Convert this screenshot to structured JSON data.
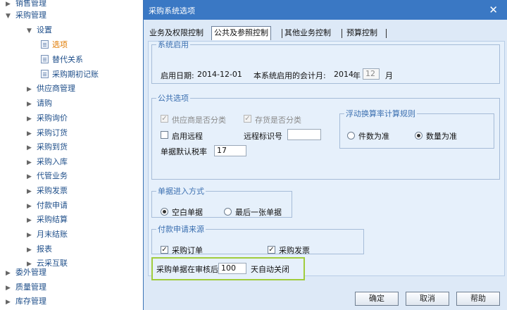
{
  "nav": {
    "items": [
      {
        "label": "销售管理",
        "arrow": "▶",
        "level": 1
      },
      {
        "label": "采购管理",
        "arrow": "▼",
        "level": 1
      },
      {
        "label": "设置",
        "arrow": "▼",
        "level": 2
      },
      {
        "label": "选项",
        "icon": "document-icon",
        "level": 3,
        "selected": true
      },
      {
        "label": "替代关系",
        "icon": "document-icon",
        "level": 3
      },
      {
        "label": "采购期初记账",
        "icon": "document-icon",
        "level": 3
      },
      {
        "label": "供应商管理",
        "arrow": "▶",
        "level": 2
      },
      {
        "label": "请购",
        "arrow": "▶",
        "level": 2
      },
      {
        "label": "采购询价",
        "arrow": "▶",
        "level": 2
      },
      {
        "label": "采购订货",
        "arrow": "▶",
        "level": 2
      },
      {
        "label": "采购到货",
        "arrow": "▶",
        "level": 2
      },
      {
        "label": "采购入库",
        "arrow": "▶",
        "level": 2
      },
      {
        "label": "代管业务",
        "arrow": "▶",
        "level": 2
      },
      {
        "label": "采购发票",
        "arrow": "▶",
        "level": 2
      },
      {
        "label": "付款申请",
        "arrow": "▶",
        "level": 2
      },
      {
        "label": "采购结算",
        "arrow": "▶",
        "level": 2
      },
      {
        "label": "月末结账",
        "arrow": "▶",
        "level": 2
      },
      {
        "label": "报表",
        "arrow": "▶",
        "level": 2
      },
      {
        "label": "云采互联",
        "arrow": "▶",
        "level": 2
      },
      {
        "label": "委外管理",
        "arrow": "▶",
        "level": 1
      },
      {
        "label": "质量管理",
        "arrow": "▶",
        "level": 1
      },
      {
        "label": "库存管理",
        "arrow": "▶",
        "level": 1
      }
    ]
  },
  "dialog": {
    "title": "采购系统选项",
    "close": "✕",
    "tabs": [
      "业务及权限控制",
      "公共及参照控制",
      "其他业务控制",
      "预算控制"
    ],
    "active_tab": 1,
    "system_enable": {
      "legend": "系统启用",
      "start_date_label": "启用日期:",
      "start_date": "2014-12-01",
      "period_label": "本系统启用的会计月:",
      "year": "2014",
      "year_unit": "年",
      "month": "12",
      "month_unit": "月"
    },
    "common": {
      "legend": "公共选项",
      "vendor_classify": "供应商是否分类",
      "inventory_classify": "存货是否分类",
      "enable_remote": "启用远程",
      "remote_id_label": "远程标识号",
      "remote_id_value": "",
      "tax_label": "单据默认税率",
      "tax_value": "17",
      "float_rule": {
        "legend": "浮动换算率计算规则",
        "piece": "件数为准",
        "quantity": "数量为准",
        "selected": "quantity"
      }
    },
    "doc_entry": {
      "legend": "单据进入方式",
      "blank": "空白单据",
      "last": "最后一张单据",
      "selected": "blank"
    },
    "payment_source": {
      "legend": "付款申请来源",
      "order": "采购订单",
      "invoice": "采购发票"
    },
    "auto_close": {
      "prefix": "采购单据在审核后",
      "days": "100",
      "suffix": "天自动关闭"
    },
    "buttons": {
      "ok": "确定",
      "cancel": "取消",
      "help": "帮助"
    }
  },
  "colors": {
    "titlebar": "#3a78c4",
    "highlight": "#a0cc3c",
    "legend": "#3b6fb0",
    "selected_nav": "#e07a00"
  }
}
